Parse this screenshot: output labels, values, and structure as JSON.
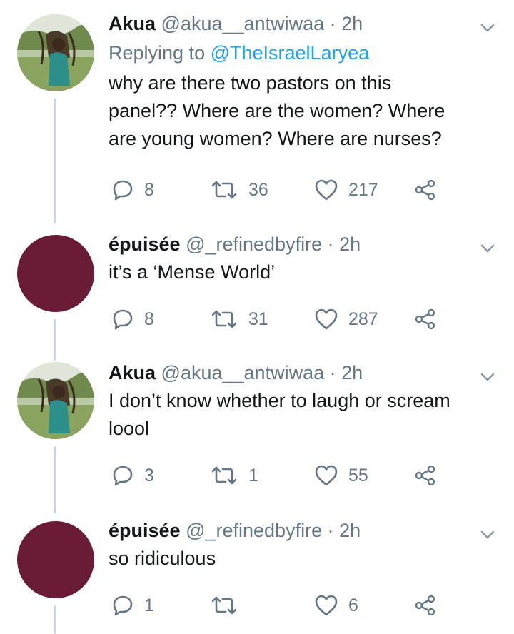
{
  "tweets": [
    {
      "name": "Akua",
      "handle": "@akua__antwiwaa",
      "time": "2h",
      "reply_prefix": "Replying to ",
      "reply_mention": "@TheIsraelLaryea",
      "lines": [
        "why are there two pastors on this",
        "panel?? Where are the women? Where",
        "are young women? Where are nurses?"
      ],
      "replies": "8",
      "retweets": "36",
      "likes": "217"
    },
    {
      "name": "épuisée",
      "handle": "@_refinedbyfire",
      "time": "2h",
      "lines": [
        "it’s a ‘Mense World’"
      ],
      "replies": "8",
      "retweets": "31",
      "likes": "287"
    },
    {
      "name": "Akua",
      "handle": "@akua__antwiwaa",
      "time": "2h",
      "lines": [
        "I don’t know whether to laugh or scream",
        "loool"
      ],
      "replies": "3",
      "retweets": "1",
      "likes": "55"
    },
    {
      "name": "épuisée",
      "handle": "@_refinedbyfire",
      "time": "2h",
      "lines": [
        "so ridiculous"
      ],
      "replies": "1",
      "retweets": "",
      "likes": "6"
    }
  ],
  "separator": " · ",
  "icons": {
    "reply": "reply-icon",
    "retweet": "retweet-icon",
    "like": "heart-icon",
    "share": "share-icon",
    "caret": "chevron-down-icon"
  },
  "colors": {
    "text": "#14171a",
    "muted": "#657786",
    "link": "#1da1f2",
    "thread_line": "#ccd6dd",
    "avatar_maroon": "#6a1b35"
  }
}
